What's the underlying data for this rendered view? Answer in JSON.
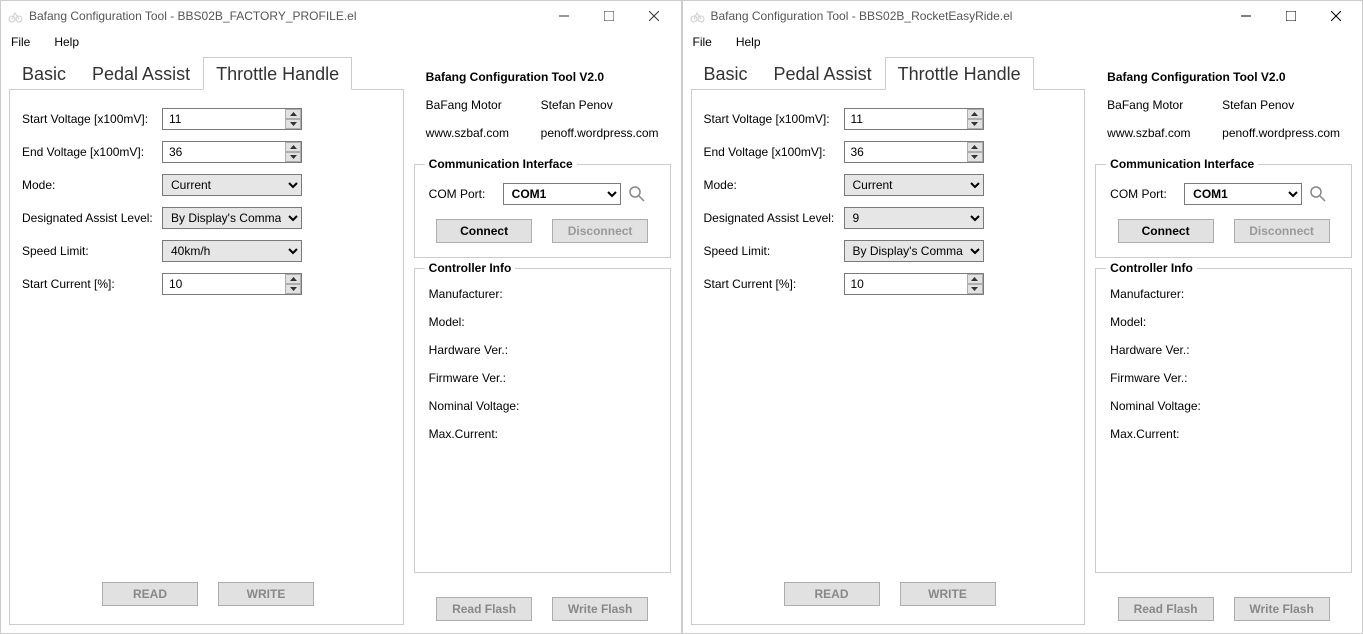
{
  "windows": [
    {
      "title": "Bafang Configuration Tool - BBS02B_FACTORY_PROFILE.el",
      "menu": {
        "file": "File",
        "help": "Help"
      },
      "tabs": {
        "basic": "Basic",
        "pedal": "Pedal Assist",
        "throttle": "Throttle Handle"
      },
      "form": {
        "start_voltage_label": "Start Voltage [x100mV]:",
        "start_voltage": "11",
        "end_voltage_label": "End Voltage [x100mV]:",
        "end_voltage": "36",
        "mode_label": "Mode:",
        "mode": "Current",
        "dal_label": "Designated Assist Level:",
        "dal": "By Display's Command",
        "speed_label": "Speed Limit:",
        "speed": "40km/h",
        "startcur_label": "Start Current [%]:",
        "startcur": "10"
      },
      "btns": {
        "read": "READ",
        "write": "WRITE"
      },
      "info": {
        "title": "Bafang Configuration Tool V2.0",
        "motor_l": "BaFang Motor",
        "motor_r": "Stefan Penov",
        "link_l": "www.szbaf.com",
        "link_r": "penoff.wordpress.com"
      },
      "comm": {
        "legend": "Communication Interface",
        "port_label": "COM Port:",
        "port": "COM1",
        "connect": "Connect",
        "disconnect": "Disconnect"
      },
      "ci": {
        "legend": "Controller Info",
        "mfr": "Manufacturer:",
        "model": "Model:",
        "hw": "Hardware Ver.:",
        "fw": "Firmware Ver.:",
        "nv": "Nominal Voltage:",
        "mc": "Max.Current:"
      },
      "rfoot": {
        "read": "Read Flash",
        "write": "Write Flash"
      }
    },
    {
      "title": "Bafang Configuration Tool - BBS02B_RocketEasyRide.el",
      "menu": {
        "file": "File",
        "help": "Help"
      },
      "tabs": {
        "basic": "Basic",
        "pedal": "Pedal Assist",
        "throttle": "Throttle Handle"
      },
      "form": {
        "start_voltage_label": "Start Voltage [x100mV]:",
        "start_voltage": "11",
        "end_voltage_label": "End Voltage [x100mV]:",
        "end_voltage": "36",
        "mode_label": "Mode:",
        "mode": "Current",
        "dal_label": "Designated Assist Level:",
        "dal": "9",
        "speed_label": "Speed Limit:",
        "speed": "By Display's Command",
        "startcur_label": "Start Current [%]:",
        "startcur": "10"
      },
      "btns": {
        "read": "READ",
        "write": "WRITE"
      },
      "info": {
        "title": "Bafang Configuration Tool V2.0",
        "motor_l": "BaFang Motor",
        "motor_r": "Stefan Penov",
        "link_l": "www.szbaf.com",
        "link_r": "penoff.wordpress.com"
      },
      "comm": {
        "legend": "Communication Interface",
        "port_label": "COM Port:",
        "port": "COM1",
        "connect": "Connect",
        "disconnect": "Disconnect"
      },
      "ci": {
        "legend": "Controller Info",
        "mfr": "Manufacturer:",
        "model": "Model:",
        "hw": "Hardware Ver.:",
        "fw": "Firmware Ver.:",
        "nv": "Nominal Voltage:",
        "mc": "Max.Current:"
      },
      "rfoot": {
        "read": "Read Flash",
        "write": "Write Flash"
      }
    }
  ]
}
